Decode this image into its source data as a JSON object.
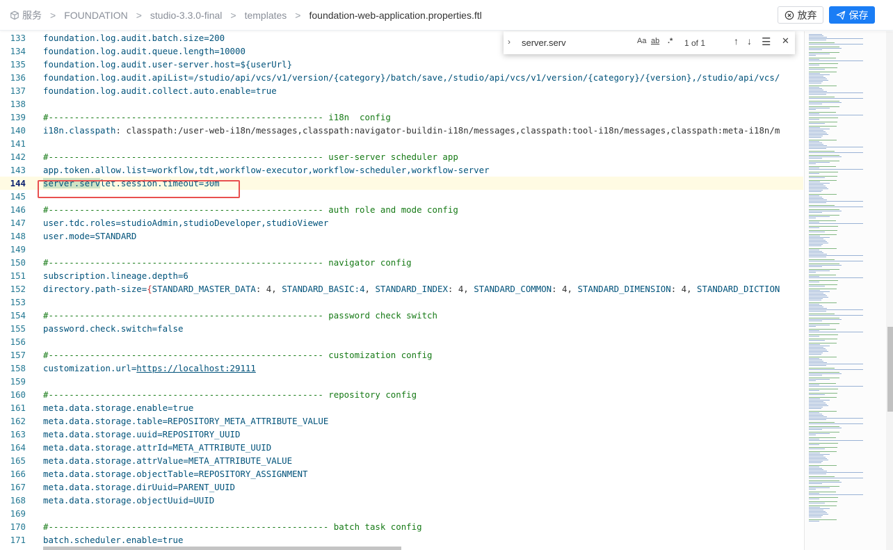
{
  "header": {
    "breadcrumb": [
      {
        "label": "服务",
        "icon": "cube-icon"
      },
      {
        "label": "FOUNDATION"
      },
      {
        "label": "studio-3.3.0-final"
      },
      {
        "label": "templates"
      },
      {
        "label": "foundation-web-application.properties.ftl"
      }
    ],
    "discard_label": "放弃",
    "save_label": "保存"
  },
  "find": {
    "query": "server.serv",
    "match_case": "Aa",
    "whole_word": "ab",
    "regex": ".*",
    "count": "1 of 1"
  },
  "editor": {
    "lines": [
      {
        "n": "133",
        "c": [
          [
            "k",
            "foundation.log.audit.batch.size=200"
          ]
        ]
      },
      {
        "n": "134",
        "c": [
          [
            "k",
            "foundation.log.audit.queue.length=10000"
          ]
        ]
      },
      {
        "n": "135",
        "c": [
          [
            "k",
            "foundation.log.audit.user-server.host=${userUrl}"
          ]
        ]
      },
      {
        "n": "136",
        "c": [
          [
            "k",
            "foundation.log.audit.apiList=/studio/api/vcs/v1/version/{category}/batch/save,/studio/api/vcs/v1/version/{category}/{version},/studio/api/vcs/"
          ]
        ]
      },
      {
        "n": "137",
        "c": [
          [
            "k",
            "foundation.log.audit.collect.auto.enable=true"
          ]
        ]
      },
      {
        "n": "138",
        "c": []
      },
      {
        "n": "139",
        "c": [
          [
            "c",
            "#----------------------------------------------------- i18n  config"
          ]
        ]
      },
      {
        "n": "140",
        "c": [
          [
            "k",
            "i18n.classpath"
          ],
          [
            "p",
            ": classpath:/user-web-i18n/messages,classpath:navigator-buildin-i18n/messages,classpath:tool-i18n/messages,classpath:meta-i18n/m"
          ]
        ]
      },
      {
        "n": "141",
        "c": []
      },
      {
        "n": "142",
        "c": [
          [
            "c",
            "#----------------------------------------------------- user-server scheduler app"
          ]
        ]
      },
      {
        "n": "143",
        "c": [
          [
            "k",
            "app.token.allow.list=workflow,tdt,workflow-executor,workflow-scheduler,workflow-server"
          ]
        ]
      },
      {
        "n": "144",
        "active": true,
        "c": [
          [
            "h",
            "server.serv"
          ],
          [
            "k",
            "let.session.timeout=30m"
          ]
        ]
      },
      {
        "n": "145",
        "c": []
      },
      {
        "n": "146",
        "c": [
          [
            "c",
            "#----------------------------------------------------- auth role and mode config"
          ]
        ]
      },
      {
        "n": "147",
        "c": [
          [
            "k",
            "user.tdc.roles=studioAdmin,studioDeveloper,studioViewer"
          ]
        ]
      },
      {
        "n": "148",
        "c": [
          [
            "k",
            "user.mode=STANDARD"
          ]
        ]
      },
      {
        "n": "149",
        "c": []
      },
      {
        "n": "150",
        "c": [
          [
            "c",
            "#----------------------------------------------------- navigator config"
          ]
        ]
      },
      {
        "n": "151",
        "c": [
          [
            "k",
            "subscription.lineage.depth=6"
          ]
        ]
      },
      {
        "n": "152",
        "c": [
          [
            "k",
            "directory.path-size="
          ],
          [
            "b",
            "{"
          ],
          [
            "k",
            "STANDARD_MASTER_DATA"
          ],
          [
            "p",
            ": 4, "
          ],
          [
            "k",
            "STANDARD_BASIC:4"
          ],
          [
            "p",
            ", "
          ],
          [
            "k",
            "STANDARD_INDEX"
          ],
          [
            "p",
            ": 4, "
          ],
          [
            "k",
            "STANDARD_COMMON"
          ],
          [
            "p",
            ": 4, "
          ],
          [
            "k",
            "STANDARD_DIMENSION"
          ],
          [
            "p",
            ": 4, "
          ],
          [
            "k",
            "STANDARD_DICTION"
          ]
        ]
      },
      {
        "n": "153",
        "c": []
      },
      {
        "n": "154",
        "c": [
          [
            "c",
            "#----------------------------------------------------- password check switch"
          ]
        ]
      },
      {
        "n": "155",
        "c": [
          [
            "k",
            "password.check.switch=false"
          ]
        ]
      },
      {
        "n": "156",
        "c": []
      },
      {
        "n": "157",
        "c": [
          [
            "c",
            "#----------------------------------------------------- customization config"
          ]
        ]
      },
      {
        "n": "158",
        "c": [
          [
            "k",
            "customization.url="
          ],
          [
            "u",
            "https://localhost:29111"
          ]
        ]
      },
      {
        "n": "159",
        "c": []
      },
      {
        "n": "160",
        "c": [
          [
            "c",
            "#----------------------------------------------------- repository config"
          ]
        ]
      },
      {
        "n": "161",
        "c": [
          [
            "k",
            "meta.data.storage.enable=true"
          ]
        ]
      },
      {
        "n": "162",
        "c": [
          [
            "k",
            "meta.data.storage.table=REPOSITORY_META_ATTRIBUTE_VALUE"
          ]
        ]
      },
      {
        "n": "163",
        "c": [
          [
            "k",
            "meta.data.storage.uuid=REPOSITORY_UUID"
          ]
        ]
      },
      {
        "n": "164",
        "c": [
          [
            "k",
            "meta.data.storage.attrId=META_ATTRIBUTE_UUID"
          ]
        ]
      },
      {
        "n": "165",
        "c": [
          [
            "k",
            "meta.data.storage.attrValue=META_ATTRIBUTE_VALUE"
          ]
        ]
      },
      {
        "n": "166",
        "c": [
          [
            "k",
            "meta.data.storage.objectTable=REPOSITORY_ASSIGNMENT"
          ]
        ]
      },
      {
        "n": "167",
        "c": [
          [
            "k",
            "meta.data.storage.dirUuid=PARENT_UUID"
          ]
        ]
      },
      {
        "n": "168",
        "c": [
          [
            "k",
            "meta.data.storage.objectUuid=UUID"
          ]
        ]
      },
      {
        "n": "169",
        "c": []
      },
      {
        "n": "170",
        "c": [
          [
            "c",
            "#------------------------------------------------------ batch task config"
          ]
        ]
      },
      {
        "n": "171",
        "c": [
          [
            "k",
            "batch.scheduler.enable=true"
          ]
        ]
      }
    ]
  }
}
